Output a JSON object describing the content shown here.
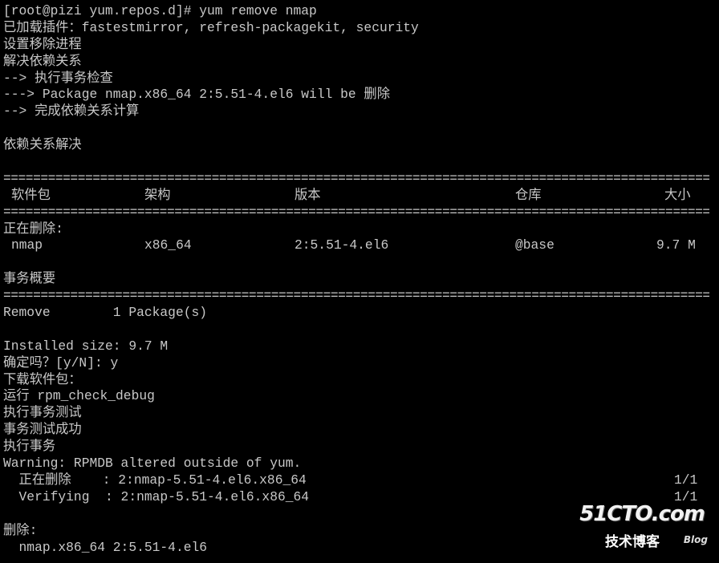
{
  "terminal": {
    "lines_top": [
      "[root@pizi yum.repos.d]# yum remove nmap",
      "已加载插件：fastestmirror, refresh-packagekit, security",
      "设置移除进程",
      "解决依赖关系",
      "--> 执行事务检查",
      "---> Package nmap.x86_64 2:5.51-4.el6 will be 删除",
      "--> 完成依赖关系计算",
      "",
      "依赖关系解决",
      ""
    ],
    "rule": "================================================================================================================",
    "table_header": {
      "package": "软件包",
      "arch": "架构",
      "version": "版本",
      "repo": "仓库",
      "size": "大小"
    },
    "removing_label": "正在删除:",
    "table_row": {
      "package": "nmap",
      "arch": "x86_64",
      "version": "2:5.51-4.el6",
      "repo": "@base",
      "size": "9.7 M"
    },
    "summary_label": "事务概要",
    "summary_line": "Remove        1 Package(s)",
    "lines_bottom": [
      "Installed size: 9.7 M",
      "确定吗？[y/N]: y",
      "下载软件包：",
      "运行 rpm_check_debug",
      "执行事务测试",
      "事务测试成功",
      "执行事务",
      "Warning: RPMDB altered outside of yum."
    ],
    "progress": [
      {
        "label": "  正在删除    : 2:nmap-5.51-4.el6.x86_64",
        "count": "1/1"
      },
      {
        "label": "  Verifying  : 2:nmap-5.51-4.el6.x86_64",
        "count": "1/1"
      }
    ],
    "removed_label": "删除:",
    "removed_item": "  nmap.x86_64 2:5.51-4.el6"
  },
  "watermark": {
    "site": "51CTO.com",
    "tagline": "技术博客",
    "blog": "Blog"
  }
}
